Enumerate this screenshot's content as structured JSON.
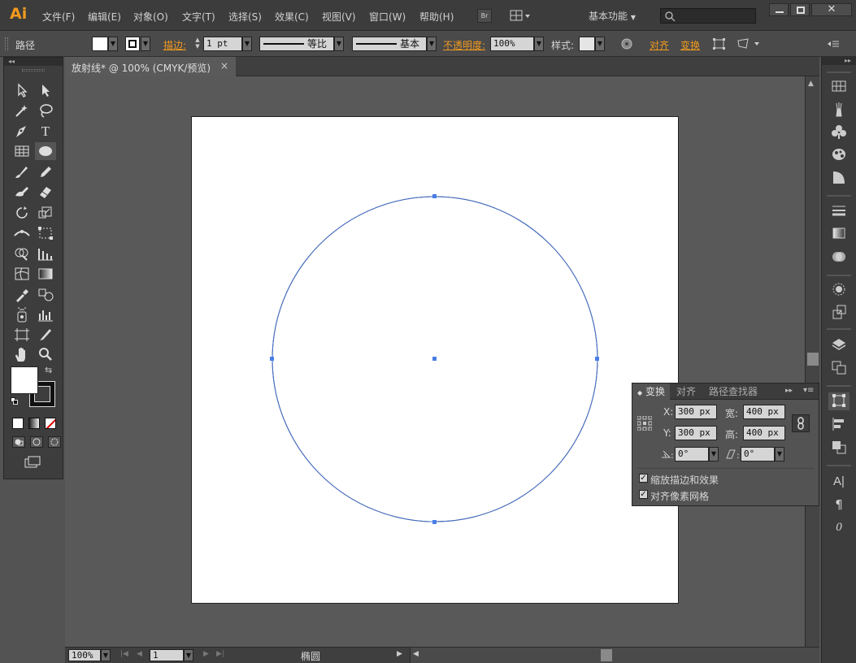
{
  "app": {
    "logo": "Ai"
  },
  "menubar": {
    "items": [
      "文件(F)",
      "编辑(E)",
      "对象(O)",
      "文字(T)",
      "选择(S)",
      "效果(C)",
      "视图(V)",
      "窗口(W)",
      "帮助(H)"
    ],
    "bridge_label": "Br",
    "workspace": "基本功能",
    "search_placeholder": ""
  },
  "controlbar": {
    "object_type": "路径",
    "stroke_label": "描边:",
    "stroke_weight": "1 pt",
    "stroke_profile": "等比",
    "brush": "基本",
    "opacity_label": "不透明度:",
    "opacity_value": "100%",
    "style_label": "样式:",
    "align_label": "对齐",
    "transform_label": "变换"
  },
  "document": {
    "tab_title": "放射线* @ 100% (CMYK/预览)",
    "close": "×"
  },
  "transform_panel": {
    "tabs": [
      "变换",
      "对齐",
      "路径查找器"
    ],
    "x_label": "X:",
    "x_value": "300 px",
    "y_label": "Y:",
    "y_value": "300 px",
    "w_label": "宽:",
    "w_value": "400 px",
    "h_label": "高:",
    "h_value": "400 px",
    "angle_value": "0°",
    "shear_value": "0°",
    "scale_strokes_label": "缩放描边和效果",
    "scale_strokes_checked": true,
    "align_pixel_label": "对齐像素网格",
    "align_pixel_checked": true
  },
  "status": {
    "zoom": "100%",
    "artboard_num": "1",
    "current_tool": "椭圆"
  },
  "colors": {
    "accent": "#f29a1e",
    "selection": "#4a7ee6",
    "ui_dark": "#3c3c3c",
    "canvas_bg": "#595959"
  }
}
